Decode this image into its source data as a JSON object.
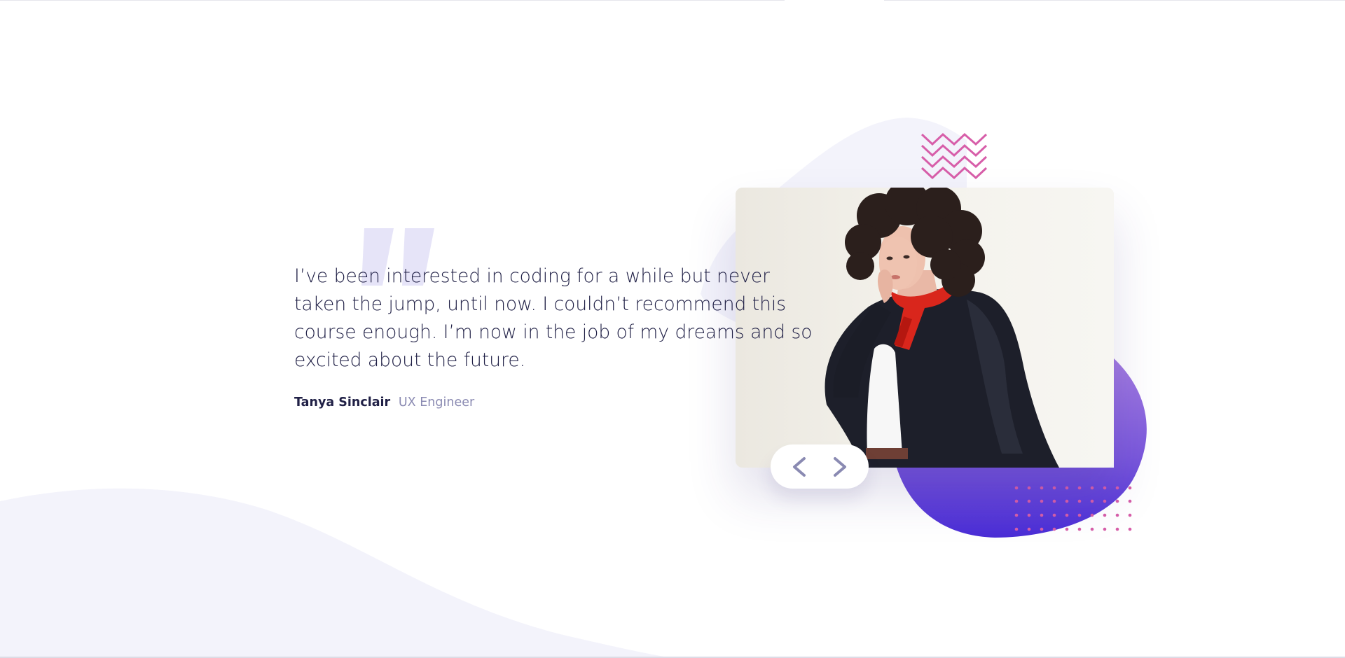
{
  "testimonial": {
    "quote": "I’ve been interested in coding for a while but never taken the jump, until now. I couldn’t recommend this course enough. I’m now in the job of my dreams and so excited about the future.",
    "author": "Tanya Sinclair",
    "role": "UX Engineer"
  },
  "photo": {
    "alt": "Portrait of Tanya Sinclair"
  },
  "controls": {
    "prev_icon": "chevron-left-icon",
    "next_icon": "chevron-right-icon"
  },
  "colors": {
    "text_dark": "#202046",
    "text_muted": "#8a8ab2",
    "bg_curve": "#f3f3fb",
    "quote_mark": "#e6e4f8",
    "blob_top": "#8a66d8",
    "blob_bottom": "#4b2fd8",
    "pattern_pink": "#d75ea9",
    "chevron": "#8a8ab2"
  }
}
